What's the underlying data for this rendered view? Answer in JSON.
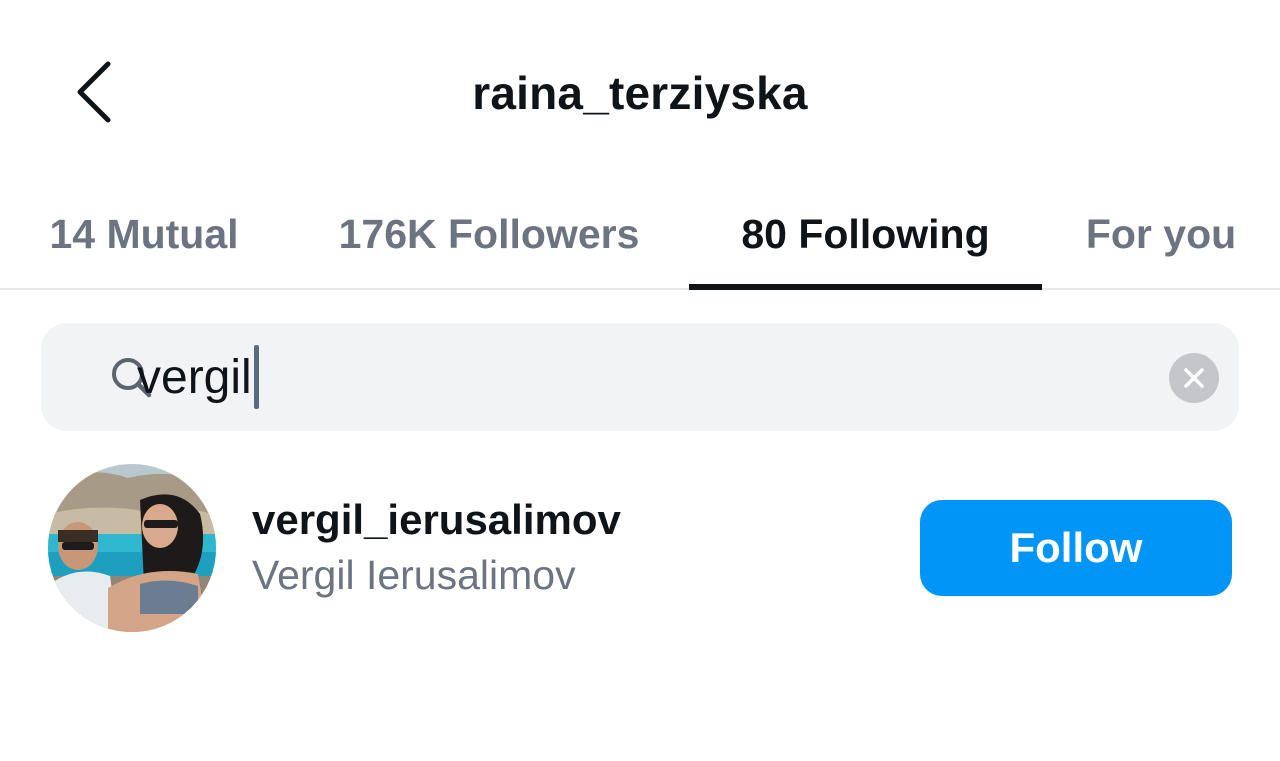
{
  "header": {
    "title": "raina_terziyska",
    "back_icon": "chevron-left-icon"
  },
  "tabs": [
    {
      "label": "14 Mutual",
      "active": false
    },
    {
      "label": "176K Followers",
      "active": false
    },
    {
      "label": "80 Following",
      "active": true
    },
    {
      "label": "For you",
      "active": false
    }
  ],
  "search": {
    "value": "vergil",
    "icon": "search-icon",
    "clear_icon": "clear-icon"
  },
  "results": [
    {
      "username": "vergil_ierusalimov",
      "full_name": "Vergil Ierusalimov",
      "button_label": "Follow"
    }
  ],
  "colors": {
    "accent": "#0095f6",
    "text_primary": "#0f1419",
    "text_secondary": "#6b7480",
    "search_bg": "#f2f3f5"
  }
}
